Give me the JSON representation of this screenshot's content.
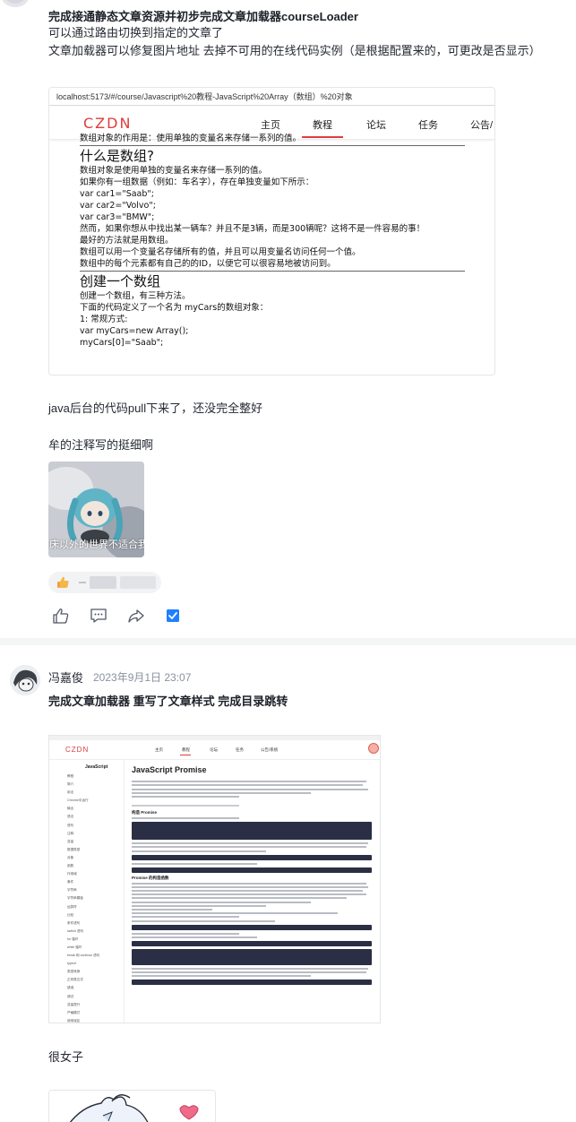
{
  "post1": {
    "title": "完成接通静态文章资源并初步完成文章加载器courseLoader",
    "line1": "可以通过路由切换到指定的文章了",
    "line2": "文章加载器可以修复图片地址 去掉不可用的在线代码实例（是根据配置来的，可更改是否显示）",
    "screenshot": {
      "url": "localhost:5173/#/course/Javascript%20教程-JavaScript%20Array（数组）%20对象",
      "logo": "CZDN",
      "nav": [
        "主页",
        "教程",
        "论坛",
        "任务",
        "公告/"
      ],
      "lines": [
        {
          "type": "text",
          "text": "数组对象的作用是：使用单独的变量名来存储一系列的值。"
        },
        {
          "type": "rule"
        },
        {
          "type": "heading",
          "text": "什么是数组?"
        },
        {
          "type": "text",
          "text": "数组对象是使用单独的变量名来存储一系列的值。"
        },
        {
          "type": "text",
          "text": "如果你有一组数据（例如：车名字），存在单独变量如下所示："
        },
        {
          "type": "text",
          "text": "var car1=\"Saab\";"
        },
        {
          "type": "text",
          "text": "var car2=\"Volvo\";"
        },
        {
          "type": "text",
          "text": "var car3=\"BMW\";"
        },
        {
          "type": "text",
          "text": "然而，如果你想从中找出某一辆车？并且不是3辆，而是300辆呢？这将不是一件容易的事！"
        },
        {
          "type": "text",
          "text": "最好的方法就是用数组。"
        },
        {
          "type": "text",
          "text": "数组可以用一个变量名存储所有的值，并且可以用变量名访问任何一个值。"
        },
        {
          "type": "text",
          "text": "数组中的每个元素都有自己的的ID，以便它可以很容易地被访问到。"
        },
        {
          "type": "rule"
        },
        {
          "type": "heading",
          "text": "创建一个数组"
        },
        {
          "type": "text",
          "text": "创建一个数组，有三种方法。"
        },
        {
          "type": "text",
          "text": "下面的代码定义了一个名为 myCars的数组对象："
        },
        {
          "type": "text",
          "text": "1: 常规方式:"
        },
        {
          "type": "text",
          "text": "var myCars=new Array();"
        },
        {
          "type": "text",
          "text": "myCars[0]=\"Saab\";"
        }
      ]
    },
    "line3": "java后台的代码pull下来了，还没完全整好",
    "line4": "牟的注释写的挺细啊",
    "image_caption": "床以外的世界不适合我",
    "reaction_icon": "thumbs-up-emoji",
    "actions": [
      "thumbs-up-icon",
      "comment-icon",
      "share-icon",
      "checkbox-icon"
    ]
  },
  "post2": {
    "author": "冯嘉俊",
    "time": "2023年9月1日 23:07",
    "title": "完成文章加载器 重写了文章样式 完成目录跳转",
    "screenshot": {
      "logo": "CZDN",
      "nav": [
        "主页",
        "教程",
        "论坛",
        "任务",
        "公告/系统"
      ],
      "sidebar_title": "JavaScript",
      "sidebar_items": [
        "教程",
        "简介",
        "用法",
        "Chrome中运行",
        "输出",
        "语法",
        "语句",
        "注释",
        "变量",
        "数据类型",
        "对象",
        "函数",
        "作用域",
        "事件",
        "字符串",
        "字符串模板",
        "运算符",
        "比较",
        "条件语句",
        "switch 语句",
        "for 循环",
        "while 循环",
        "break 和 continue 语句",
        "typeof",
        "类型转换",
        "正则表达式",
        "错误",
        "调试",
        "变量提升",
        "严格模式",
        "使用误区"
      ],
      "article_title": "JavaScript Promise",
      "section_create": "构造 Promise",
      "section_funcs": "Promise 的构造函数"
    },
    "line1": "很女子"
  },
  "colors": {
    "brand_red": "#e03c3c",
    "code_block": "#2b2f45",
    "check_blue": "#1e80ff"
  }
}
